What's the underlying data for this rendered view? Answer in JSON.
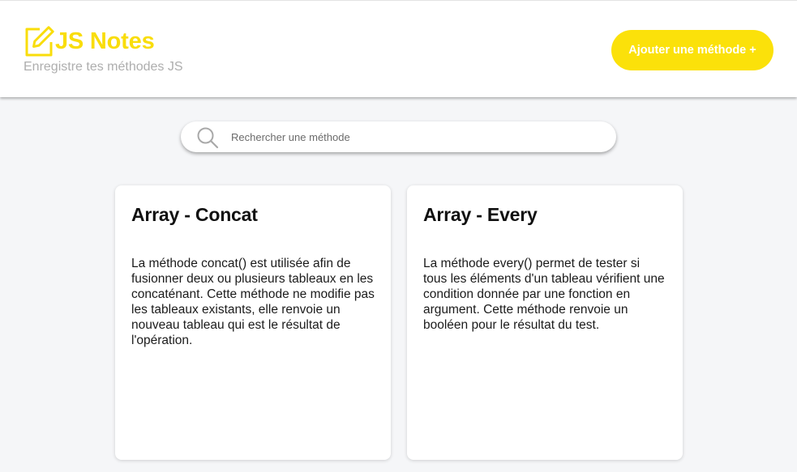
{
  "header": {
    "logo_icon": "edit-note-icon",
    "title": "JS Notes",
    "subtitle": "Enregistre tes méthodes JS",
    "add_button_label": "Ajouter une méthode +",
    "accent_color": "#fbe10a"
  },
  "search": {
    "icon": "search-icon",
    "placeholder": "Rechercher une méthode",
    "value": ""
  },
  "cards": [
    {
      "title": "Array - Concat",
      "description": "La méthode concat() est utilisée afin de fusionner deux ou plusieurs tableaux en les concaténant. Cette méthode ne modifie pas les tableaux existants, elle renvoie un nouveau tableau qui est le résultat de l'opération."
    },
    {
      "title": "Array - Every",
      "description": "La méthode every() permet de tester si tous les éléments d'un tableau vérifient une condition donnée par une fonction en argument. Cette méthode renvoie un booléen pour le résultat du test."
    }
  ]
}
